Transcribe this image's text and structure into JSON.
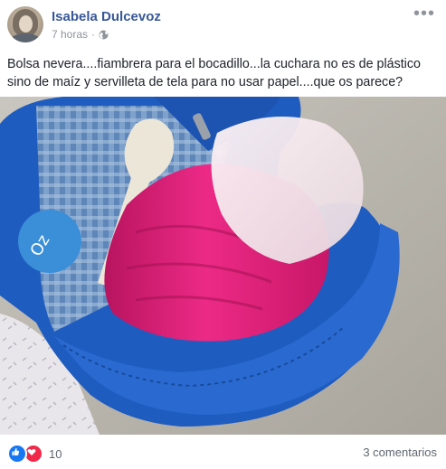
{
  "post": {
    "author": "Isabela Dulcevoz",
    "time": "7 horas",
    "separator": "·",
    "privacy_icon": "globe-icon",
    "more_icon": "more-options-icon",
    "text": "Bolsa nevera....fiambrera para el bocadillo...la cuchara no es de plástico sino de maíz y servilleta de tela para no usar papel....que os parece?"
  },
  "reactions": {
    "icons": [
      "like-icon",
      "love-icon"
    ],
    "count": "10"
  },
  "comments": {
    "label": "3 comentarios"
  },
  "colors": {
    "name": "#385898",
    "meta": "#90949c",
    "like": "#1877f2",
    "love": "#f0284a"
  }
}
